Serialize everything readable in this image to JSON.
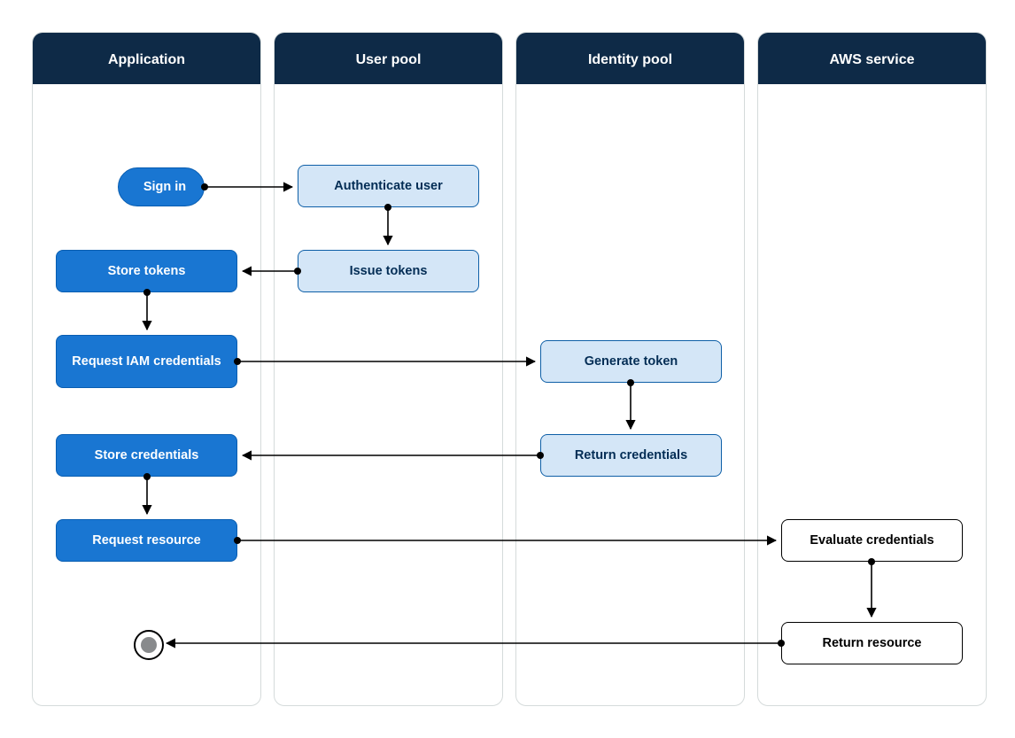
{
  "lanes": [
    {
      "id": "application",
      "title": "Application"
    },
    {
      "id": "user-pool",
      "title": "User pool"
    },
    {
      "id": "identity-pool",
      "title": "Identity pool"
    },
    {
      "id": "aws-service",
      "title": "AWS service"
    }
  ],
  "nodes": {
    "signin": "Sign in",
    "authenticate_user": "Authenticate user",
    "issue_tokens": "Issue tokens",
    "store_tokens": "Store tokens",
    "request_iam": "Request IAM credentials",
    "generate_token": "Generate token",
    "return_creds": "Return credentials",
    "store_creds": "Store credentials",
    "request_resource": "Request resource",
    "eval_creds": "Evaluate credentials",
    "return_resource": "Return resource"
  },
  "flows": [
    [
      "signin",
      "authenticate_user"
    ],
    [
      "authenticate_user",
      "issue_tokens"
    ],
    [
      "issue_tokens",
      "store_tokens"
    ],
    [
      "store_tokens",
      "request_iam"
    ],
    [
      "request_iam",
      "generate_token"
    ],
    [
      "generate_token",
      "return_creds"
    ],
    [
      "return_creds",
      "store_creds"
    ],
    [
      "store_creds",
      "request_resource"
    ],
    [
      "request_resource",
      "eval_creds"
    ],
    [
      "eval_creds",
      "return_resource"
    ],
    [
      "return_resource",
      "end"
    ]
  ],
  "colors": {
    "lane_header": "#0e2a47",
    "dark_node": "#1976d2",
    "light_node": "#d4e6f7",
    "border": "#d5dbdb"
  }
}
